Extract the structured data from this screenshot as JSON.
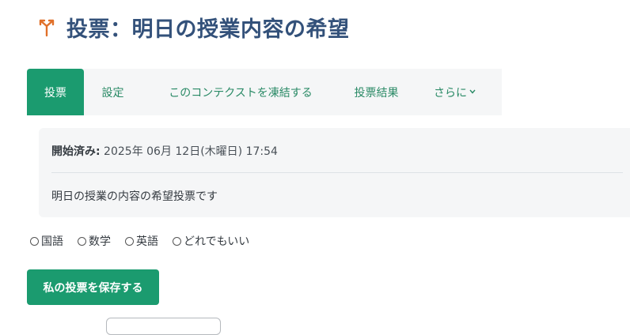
{
  "page": {
    "title": "投票：明日の授業内容の希望",
    "icon": "choice-icon",
    "accent_color": "#1b9b6f",
    "title_color": "#33517a"
  },
  "tabs": [
    {
      "label": "投票",
      "active": true
    },
    {
      "label": "設定",
      "active": false
    },
    {
      "label": "このコンテクストを凍結する",
      "active": false
    },
    {
      "label": "投票結果",
      "active": false
    },
    {
      "label": "さらに",
      "active": false,
      "icon": "chevron-down-icon"
    }
  ],
  "info": {
    "opened_label": "開始済み:",
    "opened_value": " 2025年 06月 12日(木曜日) 17:54",
    "description": "明日の授業の内容の希望投票です"
  },
  "options": [
    "国語",
    "数学",
    "英語",
    "どれでもいい"
  ],
  "save_button": "私の投票を保存する"
}
